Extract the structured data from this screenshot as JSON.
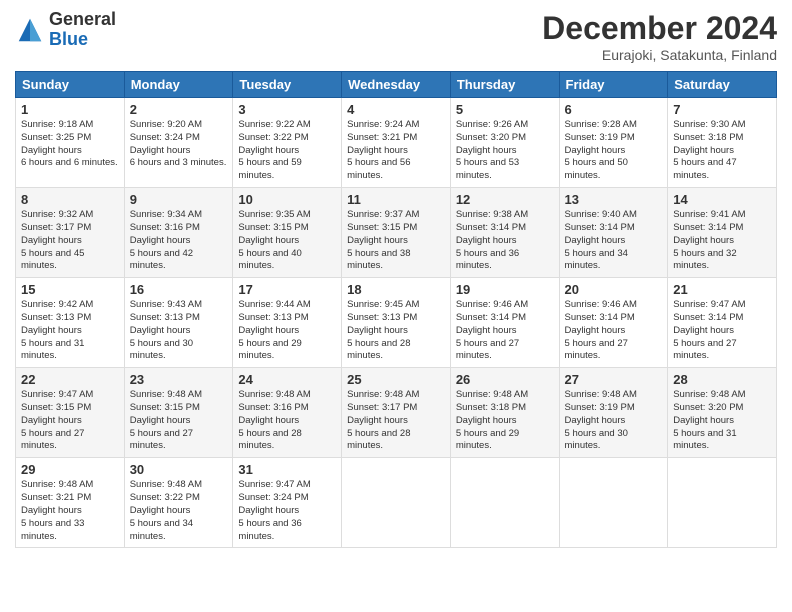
{
  "logo": {
    "general": "General",
    "blue": "Blue"
  },
  "title": "December 2024",
  "location": "Eurajoki, Satakunta, Finland",
  "days_of_week": [
    "Sunday",
    "Monday",
    "Tuesday",
    "Wednesday",
    "Thursday",
    "Friday",
    "Saturday"
  ],
  "weeks": [
    [
      {
        "day": "1",
        "sunrise": "9:18 AM",
        "sunset": "3:25 PM",
        "daylight": "6 hours and 6 minutes."
      },
      {
        "day": "2",
        "sunrise": "9:20 AM",
        "sunset": "3:24 PM",
        "daylight": "6 hours and 3 minutes."
      },
      {
        "day": "3",
        "sunrise": "9:22 AM",
        "sunset": "3:22 PM",
        "daylight": "5 hours and 59 minutes."
      },
      {
        "day": "4",
        "sunrise": "9:24 AM",
        "sunset": "3:21 PM",
        "daylight": "5 hours and 56 minutes."
      },
      {
        "day": "5",
        "sunrise": "9:26 AM",
        "sunset": "3:20 PM",
        "daylight": "5 hours and 53 minutes."
      },
      {
        "day": "6",
        "sunrise": "9:28 AM",
        "sunset": "3:19 PM",
        "daylight": "5 hours and 50 minutes."
      },
      {
        "day": "7",
        "sunrise": "9:30 AM",
        "sunset": "3:18 PM",
        "daylight": "5 hours and 47 minutes."
      }
    ],
    [
      {
        "day": "8",
        "sunrise": "9:32 AM",
        "sunset": "3:17 PM",
        "daylight": "5 hours and 45 minutes."
      },
      {
        "day": "9",
        "sunrise": "9:34 AM",
        "sunset": "3:16 PM",
        "daylight": "5 hours and 42 minutes."
      },
      {
        "day": "10",
        "sunrise": "9:35 AM",
        "sunset": "3:15 PM",
        "daylight": "5 hours and 40 minutes."
      },
      {
        "day": "11",
        "sunrise": "9:37 AM",
        "sunset": "3:15 PM",
        "daylight": "5 hours and 38 minutes."
      },
      {
        "day": "12",
        "sunrise": "9:38 AM",
        "sunset": "3:14 PM",
        "daylight": "5 hours and 36 minutes."
      },
      {
        "day": "13",
        "sunrise": "9:40 AM",
        "sunset": "3:14 PM",
        "daylight": "5 hours and 34 minutes."
      },
      {
        "day": "14",
        "sunrise": "9:41 AM",
        "sunset": "3:14 PM",
        "daylight": "5 hours and 32 minutes."
      }
    ],
    [
      {
        "day": "15",
        "sunrise": "9:42 AM",
        "sunset": "3:13 PM",
        "daylight": "5 hours and 31 minutes."
      },
      {
        "day": "16",
        "sunrise": "9:43 AM",
        "sunset": "3:13 PM",
        "daylight": "5 hours and 30 minutes."
      },
      {
        "day": "17",
        "sunrise": "9:44 AM",
        "sunset": "3:13 PM",
        "daylight": "5 hours and 29 minutes."
      },
      {
        "day": "18",
        "sunrise": "9:45 AM",
        "sunset": "3:13 PM",
        "daylight": "5 hours and 28 minutes."
      },
      {
        "day": "19",
        "sunrise": "9:46 AM",
        "sunset": "3:14 PM",
        "daylight": "5 hours and 27 minutes."
      },
      {
        "day": "20",
        "sunrise": "9:46 AM",
        "sunset": "3:14 PM",
        "daylight": "5 hours and 27 minutes."
      },
      {
        "day": "21",
        "sunrise": "9:47 AM",
        "sunset": "3:14 PM",
        "daylight": "5 hours and 27 minutes."
      }
    ],
    [
      {
        "day": "22",
        "sunrise": "9:47 AM",
        "sunset": "3:15 PM",
        "daylight": "5 hours and 27 minutes."
      },
      {
        "day": "23",
        "sunrise": "9:48 AM",
        "sunset": "3:15 PM",
        "daylight": "5 hours and 27 minutes."
      },
      {
        "day": "24",
        "sunrise": "9:48 AM",
        "sunset": "3:16 PM",
        "daylight": "5 hours and 28 minutes."
      },
      {
        "day": "25",
        "sunrise": "9:48 AM",
        "sunset": "3:17 PM",
        "daylight": "5 hours and 28 minutes."
      },
      {
        "day": "26",
        "sunrise": "9:48 AM",
        "sunset": "3:18 PM",
        "daylight": "5 hours and 29 minutes."
      },
      {
        "day": "27",
        "sunrise": "9:48 AM",
        "sunset": "3:19 PM",
        "daylight": "5 hours and 30 minutes."
      },
      {
        "day": "28",
        "sunrise": "9:48 AM",
        "sunset": "3:20 PM",
        "daylight": "5 hours and 31 minutes."
      }
    ],
    [
      {
        "day": "29",
        "sunrise": "9:48 AM",
        "sunset": "3:21 PM",
        "daylight": "5 hours and 33 minutes."
      },
      {
        "day": "30",
        "sunrise": "9:48 AM",
        "sunset": "3:22 PM",
        "daylight": "5 hours and 34 minutes."
      },
      {
        "day": "31",
        "sunrise": "9:47 AM",
        "sunset": "3:24 PM",
        "daylight": "5 hours and 36 minutes."
      },
      null,
      null,
      null,
      null
    ]
  ]
}
